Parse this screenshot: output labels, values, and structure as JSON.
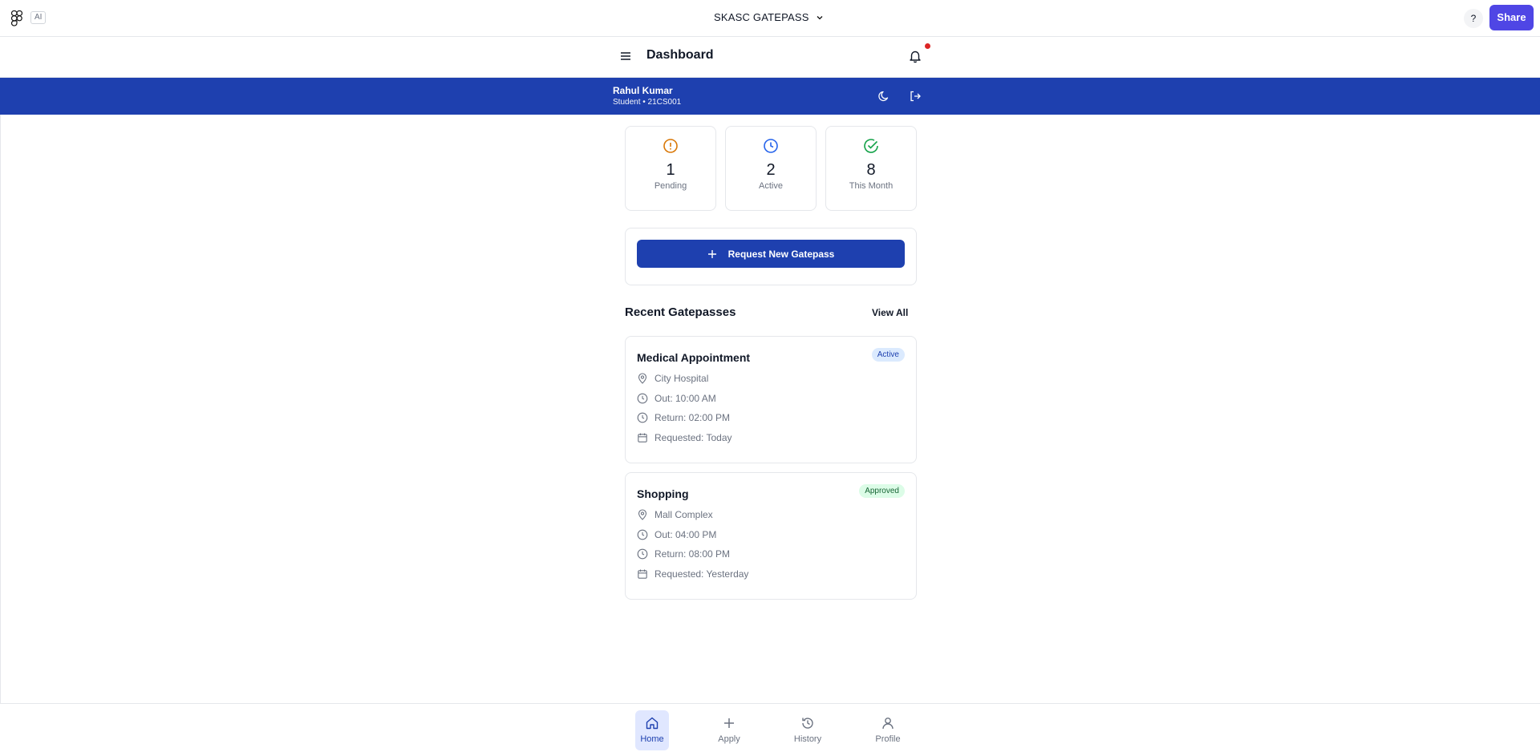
{
  "chrome": {
    "ai_label": "AI",
    "project_title": "SKASC GATEPASS",
    "help_label": "?",
    "share_label": "Share"
  },
  "header": {
    "title": "Dashboard"
  },
  "user": {
    "name": "Rahul Kumar",
    "meta": "Student • 21CS001"
  },
  "stats": [
    {
      "value": "1",
      "label": "Pending",
      "icon": "alert-circle-icon",
      "color": "#d97706"
    },
    {
      "value": "2",
      "label": "Active",
      "icon": "clock-icon",
      "color": "#2563eb"
    },
    {
      "value": "8",
      "label": "This Month",
      "icon": "check-circle-icon",
      "color": "#16a34a"
    }
  ],
  "request": {
    "button_label": "Request New Gatepass"
  },
  "recent": {
    "title": "Recent Gatepasses",
    "view_all": "View All",
    "items": [
      {
        "title": "Medical Appointment",
        "status": "Active",
        "location": "City Hospital",
        "out": "Out: 10:00 AM",
        "return": "Return: 02:00 PM",
        "requested": "Requested: Today"
      },
      {
        "title": "Shopping",
        "status": "Approved",
        "location": "Mall Complex",
        "out": "Out: 04:00 PM",
        "return": "Return: 08:00 PM",
        "requested": "Requested: Yesterday"
      }
    ]
  },
  "nav": {
    "items": [
      {
        "label": "Home",
        "icon": "home-icon",
        "active": true
      },
      {
        "label": "Apply",
        "icon": "plus-icon",
        "active": false
      },
      {
        "label": "History",
        "icon": "history-icon",
        "active": false
      },
      {
        "label": "Profile",
        "icon": "user-icon",
        "active": false
      }
    ]
  },
  "colors": {
    "primary": "#1e40af",
    "share": "#4f46e5",
    "notification_dot": "#dc2626"
  }
}
